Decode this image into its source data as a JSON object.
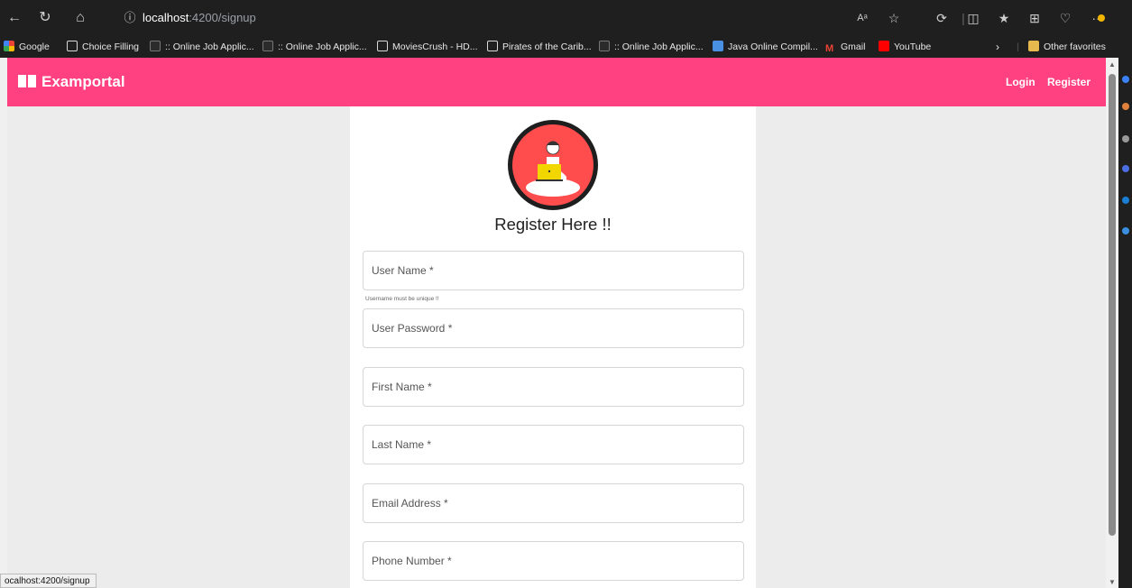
{
  "browser": {
    "url_host": "localhost",
    "url_rest": ":4200/signup",
    "read_aloud_label": "Aᵃ",
    "status_url": "ocalhost:4200/signup"
  },
  "bookmarks": [
    {
      "label": "Google",
      "icon": "google-icon"
    },
    {
      "label": "Choice Filling",
      "icon": "page-icon"
    },
    {
      "label": ":: Online Job Applic...",
      "icon": "job-site-icon"
    },
    {
      "label": ":: Online Job Applic...",
      "icon": "job-site-icon"
    },
    {
      "label": "MoviesCrush - HD...",
      "icon": "page-icon"
    },
    {
      "label": "Pirates of the Carib...",
      "icon": "page-icon"
    },
    {
      "label": ":: Online Job Applic...",
      "icon": "job-site-icon"
    },
    {
      "label": "Java Online Compil...",
      "icon": "java-icon"
    },
    {
      "label": "Gmail",
      "icon": "gmail-icon"
    },
    {
      "label": "YouTube",
      "icon": "youtube-icon"
    }
  ],
  "other_favorites": "Other favorites",
  "app": {
    "brand": "Examportal",
    "nav_login": "Login",
    "nav_register": "Register",
    "accent": "#ff4081"
  },
  "form": {
    "title": "Register Here !!",
    "username_placeholder": "User Name *",
    "username_hint": "Username must be unique !!",
    "password_placeholder": "User Password *",
    "firstname_placeholder": "First Name *",
    "lastname_placeholder": "Last Name *",
    "email_placeholder": "Email Address *",
    "phone_placeholder": "Phone Number *"
  }
}
